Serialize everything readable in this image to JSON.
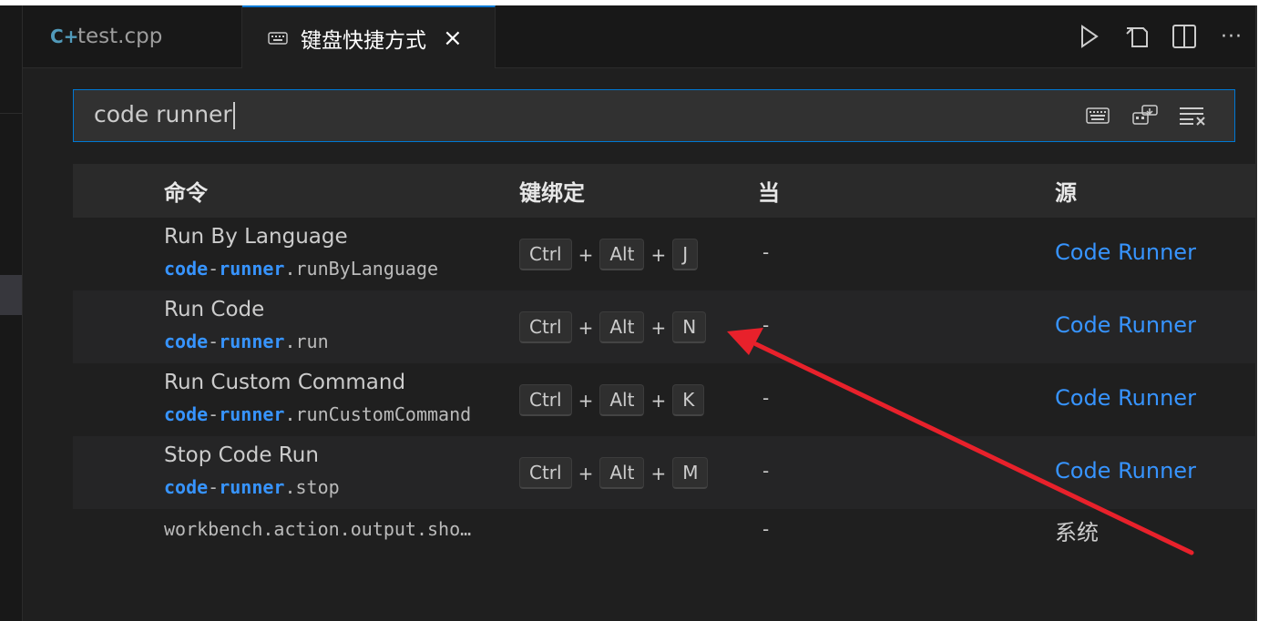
{
  "tabs": [
    {
      "icon": "cpp-file-icon",
      "glyph": "C+",
      "label": "test.cpp"
    },
    {
      "icon": "keyboard-icon",
      "label": "键盘快捷方式",
      "close": "×"
    }
  ],
  "editor_actions": [
    "run-icon",
    "open-json-icon",
    "split-editor-icon",
    "more-actions-icon"
  ],
  "editor_actions_glyphs": {
    "run": "▷",
    "more": "···"
  },
  "search": {
    "value": "code runner",
    "icons": [
      "record-keys-icon",
      "sort-by-precedence-icon",
      "clear-search-icon"
    ]
  },
  "table": {
    "headers": {
      "command": "命令",
      "keybinding": "键绑定",
      "when": "当",
      "source": "源"
    },
    "rows": [
      {
        "title": "Run By Language",
        "id_prefix_1": "code",
        "id_dash": "-",
        "id_prefix_2": "runner",
        "id_rest": ".runByLanguage",
        "keys": [
          "Ctrl",
          "Alt",
          "J"
        ],
        "plus": "+",
        "when": "-",
        "source": "Code Runner"
      },
      {
        "title": "Run Code",
        "id_prefix_1": "code",
        "id_dash": "-",
        "id_prefix_2": "runner",
        "id_rest": ".run",
        "keys": [
          "Ctrl",
          "Alt",
          "N"
        ],
        "plus": "+",
        "when": "-",
        "source": "Code Runner"
      },
      {
        "title": "Run Custom Command",
        "id_prefix_1": "code",
        "id_dash": "-",
        "id_prefix_2": "runner",
        "id_rest": ".runCustomCommand",
        "keys": [
          "Ctrl",
          "Alt",
          "K"
        ],
        "plus": "+",
        "when": "-",
        "source": "Code Runner"
      },
      {
        "title": "Stop Code Run",
        "id_prefix_1": "code",
        "id_dash": "-",
        "id_prefix_2": "runner",
        "id_rest": ".stop",
        "keys": [
          "Ctrl",
          "Alt",
          "M"
        ],
        "plus": "+",
        "when": "-",
        "source": "Code Runner"
      },
      {
        "command_only": "workbench.action.output.sho…",
        "when": "-",
        "source": "系统"
      }
    ]
  },
  "annotation": {
    "color": "#e8212b",
    "shape": "arrow"
  }
}
